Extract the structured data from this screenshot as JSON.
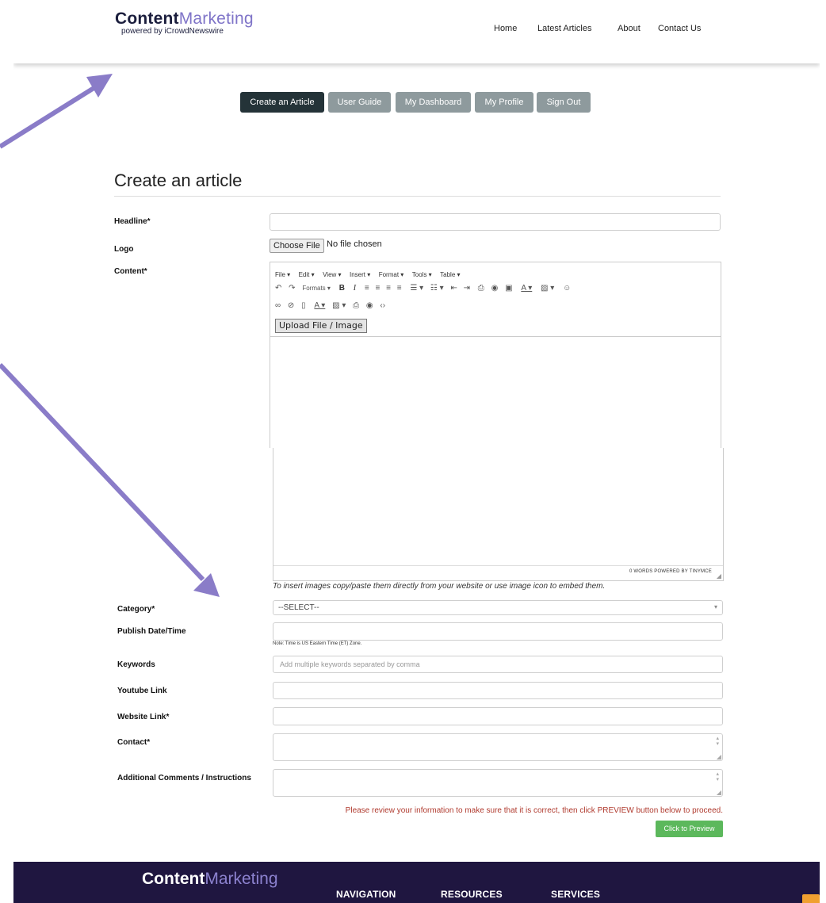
{
  "header": {
    "logo_bold": "Content",
    "logo_light": "Marketing",
    "logo_sub": "powered by iCrowdNewswire",
    "nav": [
      "Home",
      "Latest Articles",
      "About",
      "Contact Us"
    ]
  },
  "tabs": [
    "Create an Article",
    "User Guide",
    "My Dashboard",
    "My Profile",
    "Sign Out"
  ],
  "page_title": "Create an article",
  "form": {
    "headline_label": "Headline*",
    "logo_label": "Logo",
    "choose_file": "Choose File",
    "no_file": "No file chosen",
    "content_label": "Content*",
    "editor_menu": [
      "File",
      "Edit",
      "View",
      "Insert",
      "Format",
      "Tools",
      "Table"
    ],
    "formats_label": "Formats",
    "upload_button": "Upload File / Image",
    "status_bar": "0 WORDS POWERED BY TINYMCE",
    "image_hint": "To insert images copy/paste them directly from your website or use image icon to embed them.",
    "category_label": "Category*",
    "category_value": "--SELECT--",
    "publish_label": "Publish Date/Time",
    "publish_note": "Note: Time is US Eastern Time (ET) Zone.",
    "keywords_label": "Keywords",
    "keywords_placeholder": "Add multiple keywords separated by comma",
    "youtube_label": "Youtube Link",
    "website_label": "Website Link*",
    "contact_label": "Contact*",
    "comments_label": "Additional Comments / Instructions",
    "review_note": "Please review your information to make sure that it is correct, then click PREVIEW button below to proceed.",
    "preview_button": "Click to Preview"
  },
  "footer": {
    "logo_bold": "Content",
    "logo_light": "Marketing",
    "nav": [
      "NAVIGATION",
      "RESOURCES",
      "SERVICES"
    ]
  },
  "colors": {
    "brand_dark": "#1b1e3d",
    "brand_light": "#7f74c8",
    "active_tab": "#243338",
    "tab": "#8e9a9d",
    "footer_bg": "#1f1640",
    "preview_button": "#5cb85c",
    "review_note": "#b03a2e",
    "annotation_arrow": "#8a7cc8"
  }
}
